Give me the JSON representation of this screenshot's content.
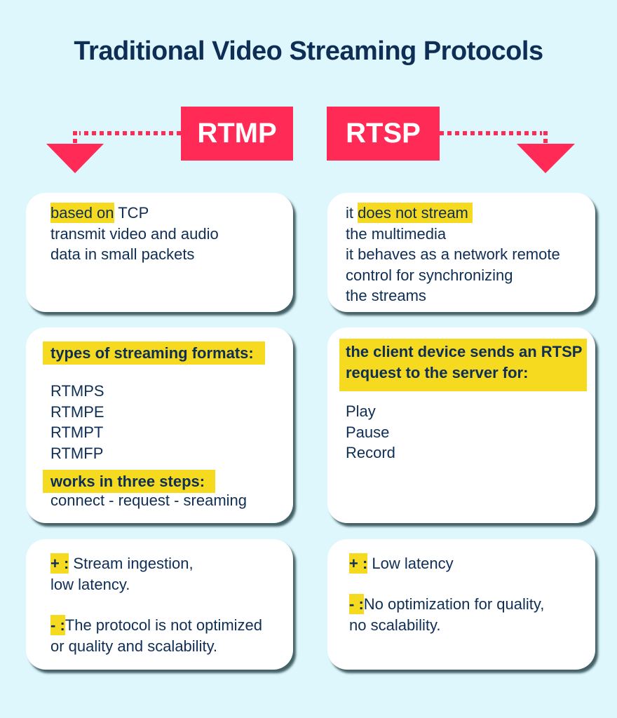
{
  "title": "Traditional Video Streaming Protocols",
  "colors": {
    "background": "#def7fd",
    "accent_red": "#ff2a55",
    "highlight_yellow": "#f5da20",
    "text_navy": "#0f2e55",
    "card": "#ffffff"
  },
  "protocols": {
    "rtmp": {
      "label": "RTMP",
      "card1": {
        "line1_highlight": "based on",
        "line1_rest": " TCP",
        "line2": "transmit video and audio",
        "line3": "data in small packets"
      },
      "card2": {
        "heading": "types of streaming formats:",
        "formats": [
          "RTMPS",
          "RTMPE",
          "RTMPT",
          "RTMFP"
        ],
        "steps_heading": "works in three steps:",
        "steps": "connect - request - sreaming"
      },
      "card3": {
        "plus_label": "+ :",
        "plus_text": " Stream ingestion,",
        "plus_text2": "low latency.",
        "minus_label": "- :",
        "minus_text": "The protocol is not optimized",
        "minus_text2": "or quality and scalability."
      }
    },
    "rtsp": {
      "label": "RTSP",
      "card1": {
        "line1_pre": "it ",
        "line1_highlight": "does not stream",
        "line2": "the multimedia",
        "line3": "it behaves as a network remote",
        "line4": "control for synchronizing",
        "line5": "the streams"
      },
      "card2": {
        "heading_line1": "the client device sends an RTSP",
        "heading_line2": "request to the server for:",
        "actions": [
          "Play",
          "Pause",
          "Record"
        ]
      },
      "card3": {
        "plus_label": "+ :",
        "plus_text": " Low latency",
        "minus_label": "- :",
        "minus_text": "No optimization for quality,",
        "minus_text2": "no scalability."
      }
    }
  }
}
